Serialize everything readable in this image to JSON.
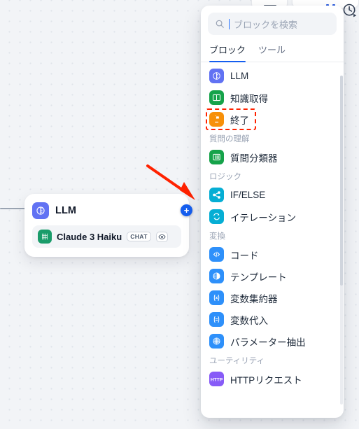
{
  "app": {
    "canvas_bg": "#f2f4f7",
    "accent": "#155eef",
    "annotation_color": "#ff2200"
  },
  "toolbar": {
    "history_icon": "history-clock-icon",
    "menu_button_label": "",
    "run_button_label": ""
  },
  "canvas": {
    "node": {
      "title": "LLM",
      "title_icon": "llm-icon",
      "add_button_label": "+",
      "model": {
        "icon": "anthropic-claude-icon",
        "name": "Claude 3 Haiku",
        "mode_badge": "CHAT",
        "visibility_icon": "eye-icon"
      }
    },
    "annotation": {
      "type": "arrow",
      "color": "#ff2200",
      "points_to": "add-block-button"
    }
  },
  "panel": {
    "search": {
      "icon": "search-icon",
      "placeholder": "ブロックを検索",
      "value": ""
    },
    "tabs": [
      {
        "label": "ブロック",
        "active": true
      },
      {
        "label": "ツール",
        "active": false
      }
    ],
    "sections": [
      {
        "label": "",
        "items": [
          {
            "label": "LLM",
            "icon": "llm-icon",
            "color": "#6172f3",
            "glyph": "llm",
            "highlighted": false
          },
          {
            "label": "知識取得",
            "icon": "knowledge-retrieval-icon",
            "color": "#16a34a",
            "glyph": "book",
            "highlighted": false
          },
          {
            "label": "終了",
            "icon": "end-icon",
            "color": "#f79009",
            "glyph": "end",
            "highlighted": true
          }
        ]
      },
      {
        "label": "質問の理解",
        "items": [
          {
            "label": "質問分類器",
            "icon": "question-classifier-icon",
            "color": "#16a34a",
            "glyph": "classifier",
            "highlighted": false
          }
        ]
      },
      {
        "label": "ロジック",
        "items": [
          {
            "label": "IF/ELSE",
            "icon": "if-else-icon",
            "color": "#06aed4",
            "glyph": "branch",
            "highlighted": false
          },
          {
            "label": "イテレーション",
            "icon": "iteration-icon",
            "color": "#06aed4",
            "glyph": "loop",
            "highlighted": false
          }
        ]
      },
      {
        "label": "変換",
        "items": [
          {
            "label": "コード",
            "icon": "code-icon",
            "color": "#2e90fa",
            "glyph": "code",
            "highlighted": false
          },
          {
            "label": "テンプレート",
            "icon": "template-icon",
            "color": "#2e90fa",
            "glyph": "template",
            "highlighted": false
          },
          {
            "label": "変数集約器",
            "icon": "variable-aggregator-icon",
            "color": "#2e90fa",
            "glyph": "varx",
            "highlighted": false
          },
          {
            "label": "変数代入",
            "icon": "variable-assigner-icon",
            "color": "#2e90fa",
            "glyph": "vareq",
            "highlighted": false
          },
          {
            "label": "パラメーター抽出",
            "icon": "parameter-extractor-icon",
            "color": "#2e90fa",
            "glyph": "grid",
            "highlighted": false
          }
        ]
      },
      {
        "label": "ユーティリティ",
        "items": [
          {
            "label": "HTTPリクエスト",
            "icon": "http-request-icon",
            "color": "#875bf7",
            "glyph": "http",
            "highlighted": false
          }
        ]
      }
    ]
  }
}
